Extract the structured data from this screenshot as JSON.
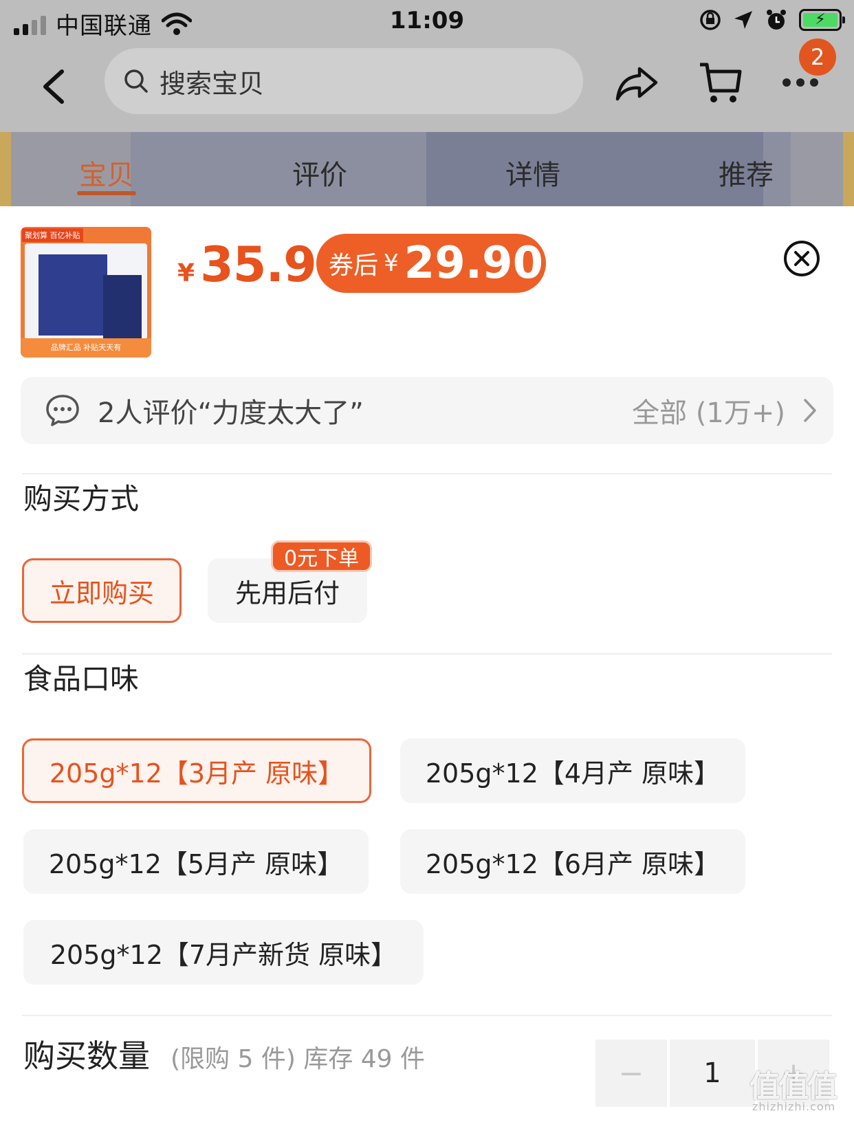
{
  "status_bar": {
    "carrier": "中国联通",
    "time": "11:09",
    "battery_icon": "charging-bolt"
  },
  "nav": {
    "search_placeholder": "搜索宝贝",
    "cart_badge": "2"
  },
  "tabs": [
    {
      "label": "宝贝",
      "active": true
    },
    {
      "label": "评价",
      "active": false
    },
    {
      "label": "详情",
      "active": false
    },
    {
      "label": "推荐",
      "active": false
    }
  ],
  "product": {
    "price_currency": "¥",
    "price": "35.9",
    "coupon_label": "券后",
    "coupon_currency": "¥",
    "coupon_price": "29.90",
    "thumb_tag": "聚划算 百亿补贴",
    "thumb_footer": "品牌汇品 补贴天天有"
  },
  "review": {
    "text": "2人评价“力度太大了”",
    "all_label": "全部 (1万+)"
  },
  "purchase_method": {
    "title": "购买方式",
    "options": [
      {
        "label": "立即购买",
        "selected": true
      },
      {
        "label": "先用后付",
        "selected": false
      }
    ],
    "badge": "0元下单"
  },
  "flavor": {
    "title": "食品口味",
    "options": [
      {
        "label": "205g*12【3月产 原味】",
        "selected": true
      },
      {
        "label": "205g*12【4月产 原味】",
        "selected": false
      },
      {
        "label": "205g*12【5月产 原味】",
        "selected": false
      },
      {
        "label": "205g*12【6月产 原味】",
        "selected": false
      },
      {
        "label": "205g*12【7月产新货 原味】",
        "selected": false
      }
    ]
  },
  "quantity": {
    "title": "购买数量",
    "limit": "(限购 5 件) 库存 49 件",
    "value": "1",
    "minus": "−",
    "plus": "+"
  },
  "watermark": {
    "logo": "值值值",
    "site": "zhizhizhi.com"
  },
  "colors": {
    "accent": "#E8521D",
    "overlay": "#BDBDBD"
  }
}
